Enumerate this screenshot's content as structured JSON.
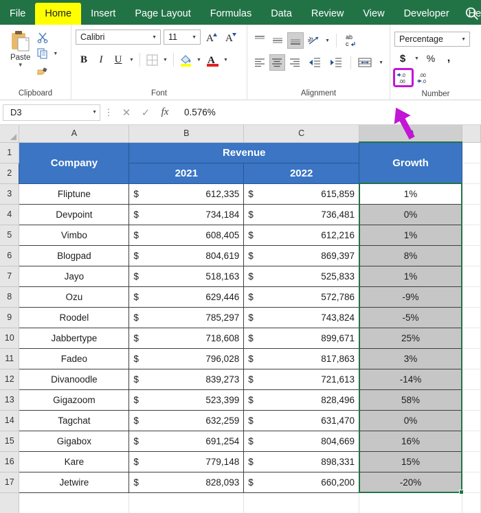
{
  "ribbon": {
    "tabs": [
      {
        "label": "File",
        "active": false
      },
      {
        "label": "Home",
        "active": true
      },
      {
        "label": "Insert",
        "active": false
      },
      {
        "label": "Page Layout",
        "active": false
      },
      {
        "label": "Formulas",
        "active": false
      },
      {
        "label": "Data",
        "active": false
      },
      {
        "label": "Review",
        "active": false
      },
      {
        "label": "View",
        "active": false
      },
      {
        "label": "Developer",
        "active": false
      },
      {
        "label": "Help",
        "active": false
      }
    ],
    "search_icon": "search-icon",
    "groups": {
      "clipboard": {
        "label": "Clipboard",
        "paste_label": "Paste",
        "items": [
          "paste-icon",
          "cut-scissors-icon",
          "copy-icon",
          "format-painter-icon"
        ]
      },
      "font": {
        "label": "Font",
        "font_name": "Calibri",
        "font_size": "11",
        "buttons": [
          "increase-font-size",
          "decrease-font-size",
          "bold",
          "italic",
          "underline",
          "borders",
          "fill-color",
          "font-color"
        ],
        "bold_label": "B",
        "italic_label": "I",
        "underline_label": "U"
      },
      "alignment": {
        "label": "Alignment",
        "buttons": [
          "top-align",
          "middle-align",
          "bottom-align",
          "orientation",
          "wrap-text",
          "align-left",
          "center",
          "align-right",
          "decrease-indent",
          "increase-indent",
          "merge-and-center"
        ],
        "wrap_text_label": "ab"
      },
      "number": {
        "label": "Number",
        "format": "Percentage",
        "accounting_symbol": "$",
        "percent_symbol": "%",
        "comma_symbol": ",",
        "decrease_decimal": "decrease-decimal-icon",
        "increase_decimal": "increase-decimal-icon",
        "highlighted_button": "increase-decimal-icon",
        "highlight_color": "#c315d6"
      }
    }
  },
  "formula_bar": {
    "name_box": "D3",
    "cancel_icon": "cancel-icon",
    "enter_icon": "confirm-check-icon",
    "function_icon": "fx",
    "formula_value": "0.576%"
  },
  "sheet": {
    "column_headers": [
      {
        "label": "A",
        "selected": false
      },
      {
        "label": "B",
        "selected": false
      },
      {
        "label": "C",
        "selected": false
      },
      {
        "label": "D",
        "selected": true
      }
    ],
    "row_headers": [
      "1",
      "2",
      "3",
      "4",
      "5",
      "6",
      "7",
      "8",
      "9",
      "10",
      "11",
      "12",
      "13",
      "14",
      "15",
      "16",
      "17"
    ],
    "header_company": "Company",
    "header_revenue": "Revenue",
    "header_2021": "2021",
    "header_2022": "2022",
    "header_growth": "Growth",
    "currency_symbol": "$",
    "active_cell": "D3",
    "selected_range": "D3:D17",
    "rows": [
      {
        "row": "3",
        "company": "Fliptune",
        "rev2021": "612,335",
        "rev2022": "615,859",
        "growth": "1%"
      },
      {
        "row": "4",
        "company": "Devpoint",
        "rev2021": "734,184",
        "rev2022": "736,481",
        "growth": "0%"
      },
      {
        "row": "5",
        "company": "Vimbo",
        "rev2021": "608,405",
        "rev2022": "612,216",
        "growth": "1%"
      },
      {
        "row": "6",
        "company": "Blogpad",
        "rev2021": "804,619",
        "rev2022": "869,397",
        "growth": "8%"
      },
      {
        "row": "7",
        "company": "Jayo",
        "rev2021": "518,163",
        "rev2022": "525,833",
        "growth": "1%"
      },
      {
        "row": "8",
        "company": "Ozu",
        "rev2021": "629,446",
        "rev2022": "572,786",
        "growth": "-9%"
      },
      {
        "row": "9",
        "company": "Roodel",
        "rev2021": "785,297",
        "rev2022": "743,824",
        "growth": "-5%"
      },
      {
        "row": "10",
        "company": "Jabbertype",
        "rev2021": "718,608",
        "rev2022": "899,671",
        "growth": "25%"
      },
      {
        "row": "11",
        "company": "Fadeo",
        "rev2021": "796,028",
        "rev2022": "817,863",
        "growth": "3%"
      },
      {
        "row": "12",
        "company": "Divanoodle",
        "rev2021": "839,273",
        "rev2022": "721,613",
        "growth": "-14%"
      },
      {
        "row": "13",
        "company": "Gigazoom",
        "rev2021": "523,399",
        "rev2022": "828,496",
        "growth": "58%"
      },
      {
        "row": "14",
        "company": "Tagchat",
        "rev2021": "632,259",
        "rev2022": "631,470",
        "growth": "0%"
      },
      {
        "row": "15",
        "company": "Gigabox",
        "rev2021": "691,254",
        "rev2022": "804,669",
        "growth": "16%"
      },
      {
        "row": "16",
        "company": "Kare",
        "rev2021": "779,148",
        "rev2022": "898,331",
        "growth": "15%"
      },
      {
        "row": "17",
        "company": "Jetwire",
        "rev2021": "828,093",
        "rev2022": "660,200",
        "growth": "-20%"
      }
    ]
  },
  "colors": {
    "ribbon_green": "#217346",
    "active_tab_yellow": "#ffff00",
    "table_header_blue": "#3b75c4",
    "selection_gray": "#c6c6c6",
    "annotation_purple": "#c315d6"
  }
}
